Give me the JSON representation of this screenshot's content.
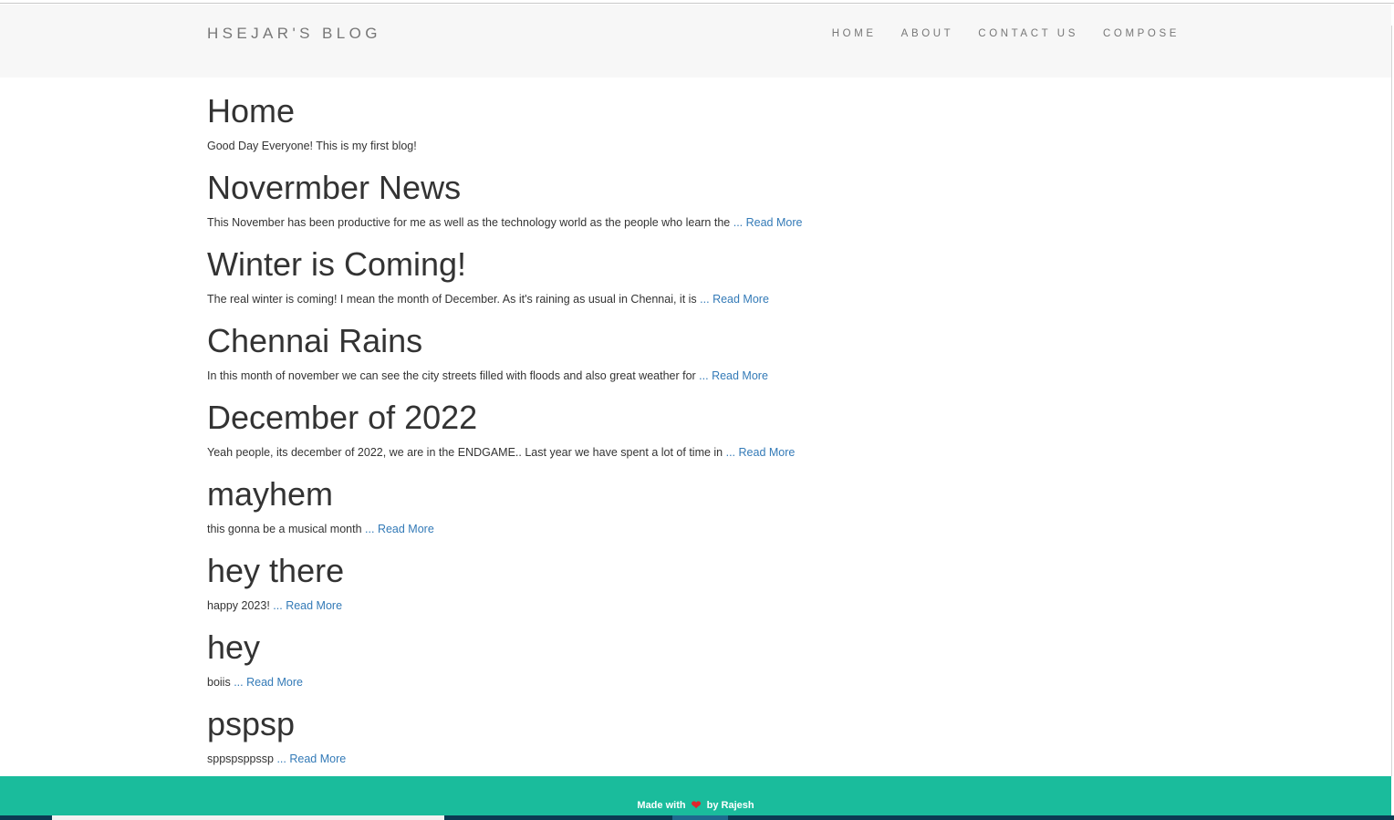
{
  "navbar": {
    "brand": "HSEJAR'S BLOG",
    "links": [
      "HOME",
      "ABOUT",
      "CONTACT US",
      "COMPOSE"
    ]
  },
  "posts": [
    {
      "title": "Home",
      "excerpt": "Good Day Everyone! This is my first blog!",
      "ellipsis": "",
      "read_more": ""
    },
    {
      "title": "Novermber News",
      "excerpt": "This November has been productive for me as well as the technology world as the people who learn the ",
      "ellipsis": "...",
      "read_more": "Read More"
    },
    {
      "title": "Winter is Coming!",
      "excerpt": "The real winter is coming! I mean the month of December. As it's raining as usual in Chennai, it is ",
      "ellipsis": "...",
      "read_more": "Read More"
    },
    {
      "title": "Chennai Rains",
      "excerpt": "In this month of november we can see the city streets filled with floods and also great weather for ",
      "ellipsis": "...",
      "read_more": "Read More"
    },
    {
      "title": "December of 2022",
      "excerpt": "Yeah people, its december of 2022, we are in the ENDGAME.. Last year we have spent a lot of time in ",
      "ellipsis": "...",
      "read_more": "Read More"
    },
    {
      "title": "mayhem",
      "excerpt": "this gonna be a musical month ",
      "ellipsis": "...",
      "read_more": "Read More"
    },
    {
      "title": "hey there",
      "excerpt": "happy 2023! ",
      "ellipsis": "...",
      "read_more": "Read More"
    },
    {
      "title": "hey",
      "excerpt": "boiis ",
      "ellipsis": "...",
      "read_more": "Read More"
    },
    {
      "title": "pspsp",
      "excerpt": "sppspsppssp ",
      "ellipsis": "...",
      "read_more": "Read More"
    }
  ],
  "footer": {
    "made_with": "Made with",
    "heart_icon": "heart-icon",
    "by": "by Rajesh",
    "background": "#1abc9c"
  },
  "colors": {
    "link": "#337ab7",
    "navbar_bg": "#f7f7f7",
    "nav_text": "#777777",
    "heart": "#e0242c"
  }
}
